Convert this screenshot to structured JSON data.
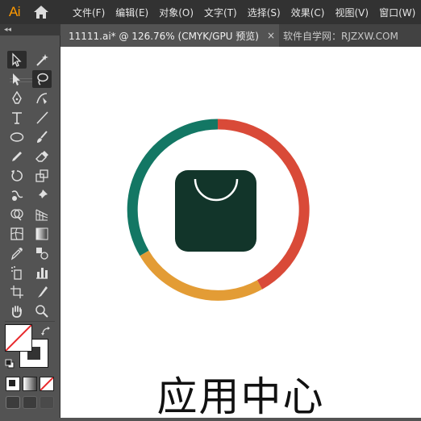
{
  "app": {
    "logo_text": "Ai"
  },
  "menu": [
    "文件(F)",
    "编辑(E)",
    "对象(O)",
    "文字(T)",
    "选择(S)",
    "效果(C)",
    "视图(V)",
    "窗口(W)"
  ],
  "tabs": {
    "active_title": "11111.ai* @ 126.76% (CMYK/GPU 预览)",
    "close_glyph": "×",
    "inactive_title": "软件自学网：RJZXW.COM"
  },
  "panel": {
    "collapse_glyph": "◂◂"
  },
  "colors": {
    "ring_red": "#d94a38",
    "ring_green": "#137764",
    "ring_orange": "#e39c35",
    "bag_fill": "#12352a",
    "logo_orange": "#ff9a00"
  },
  "artwork": {
    "caption": "应用中心"
  }
}
